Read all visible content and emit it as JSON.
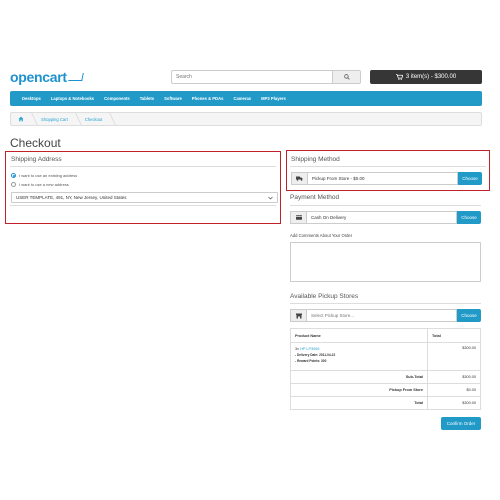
{
  "header": {
    "logo": "opencart",
    "search_placeholder": "Search",
    "cart_label": "3 item(s) - $300.00"
  },
  "menu": {
    "items": [
      "Desktops",
      "Laptops & Notebooks",
      "Components",
      "Tablets",
      "Software",
      "Phones & PDAs",
      "Cameras",
      "MP3 Players"
    ]
  },
  "breadcrumb": {
    "items": [
      "Shopping Cart",
      "Checkout"
    ]
  },
  "page": {
    "title": "Checkout"
  },
  "shipping_address": {
    "heading": "Shipping Address",
    "option_existing": "I want to use an existing address",
    "option_new": "I want to use a new address",
    "selected_address": "USER TEMPLATE, 491, NY, New Jersey, United States"
  },
  "shipping_method": {
    "heading": "Shipping Method",
    "value": "Pickup From Store - $0.00",
    "button": "Choose"
  },
  "payment_method": {
    "heading": "Payment Method",
    "value": "Cash On Delivery",
    "button": "Choose"
  },
  "comments": {
    "label": "Add Comments About Your Order"
  },
  "pickup": {
    "heading": "Available Pickup Stores",
    "placeholder": "Select Pickup Store...",
    "button": "Choose"
  },
  "order_table": {
    "col_product": "Product Name",
    "col_total": "Total",
    "product_qty": "3x",
    "product_name": "HP LP3065",
    "product_detail_1": "- Delivery Date: 2011-04-22",
    "product_detail_2": "- Reward Points: 300",
    "product_total": "$300.00",
    "rows": [
      {
        "label": "Sub-Total",
        "value": "$300.00"
      },
      {
        "label": "Pickup From Store",
        "value": "$0.00"
      },
      {
        "label": "Total",
        "value": "$300.00"
      }
    ]
  },
  "confirm": {
    "label": "Confirm Order"
  },
  "colors": {
    "accent": "#229ac8",
    "highlight_border": "#c2202a",
    "cart_button": "#363636"
  }
}
